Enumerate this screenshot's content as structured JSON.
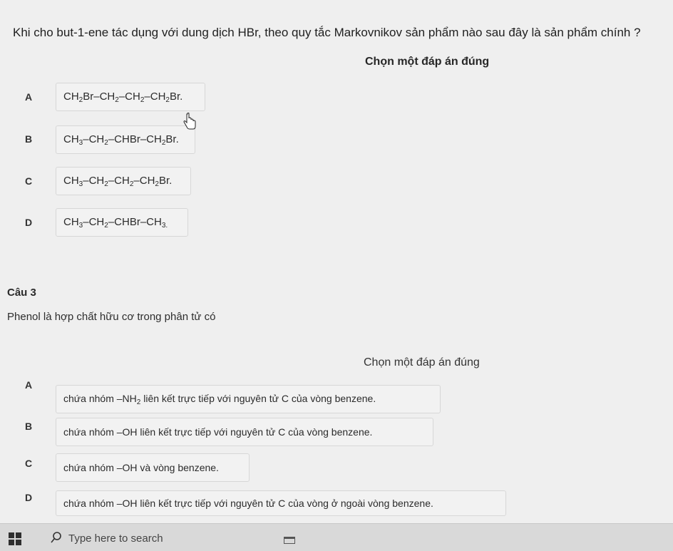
{
  "question1": {
    "prompt": "Khi cho but-1-ene tác dụng với dung dịch HBr, theo quy tắc Markovnikov sản phẩm nào sau đây là sản phẩm chính ?",
    "instruction": "Chọn một đáp án đúng",
    "options": [
      {
        "letter": "A",
        "formula": [
          [
            "CH",
            "2"
          ],
          [
            "Br–CH",
            "2"
          ],
          [
            "–CH",
            "2"
          ],
          [
            "–CH",
            "2"
          ],
          [
            "Br.",
            ""
          ]
        ]
      },
      {
        "letter": "B",
        "formula": [
          [
            "CH",
            "3"
          ],
          [
            "–CH",
            "2"
          ],
          [
            "–CHBr–CH",
            "2"
          ],
          [
            "Br.",
            ""
          ]
        ]
      },
      {
        "letter": "C",
        "formula": [
          [
            "CH",
            "3"
          ],
          [
            "–CH",
            "2"
          ],
          [
            "–CH",
            "2"
          ],
          [
            "–CH",
            "2"
          ],
          [
            "Br.",
            ""
          ]
        ]
      },
      {
        "letter": "D",
        "formula": [
          [
            "CH",
            "3"
          ],
          [
            "–CH",
            "2"
          ],
          [
            "–CHBr–CH",
            "3."
          ]
        ]
      }
    ]
  },
  "question2": {
    "title": "Câu 3",
    "text": "Phenol là hợp chất hữu cơ trong phân tử có",
    "instruction": "Chọn một đáp án đúng",
    "options": [
      {
        "letter": "A",
        "before": "chứa nhóm –NH",
        "sub": "2",
        "after": " liên kết trực tiếp với nguyên tử C của vòng benzene."
      },
      {
        "letter": "B",
        "before": "chứa nhóm –OH liên kết trực tiếp với nguyên tử C của vòng benzene.",
        "sub": "",
        "after": ""
      },
      {
        "letter": "C",
        "before": "chứa nhóm –OH và vòng benzene.",
        "sub": "",
        "after": ""
      },
      {
        "letter": "D",
        "before": "chứa nhóm –OH liên kết trực tiếp với nguyên tử C của vòng ở ngoài vòng benzene.",
        "sub": "",
        "after": ""
      }
    ]
  },
  "taskbar": {
    "search_placeholder": "Type here to search",
    "start_icon": "windows-logo-icon",
    "search_icon": "search-icon",
    "tray_icon": "task-view-icon"
  }
}
